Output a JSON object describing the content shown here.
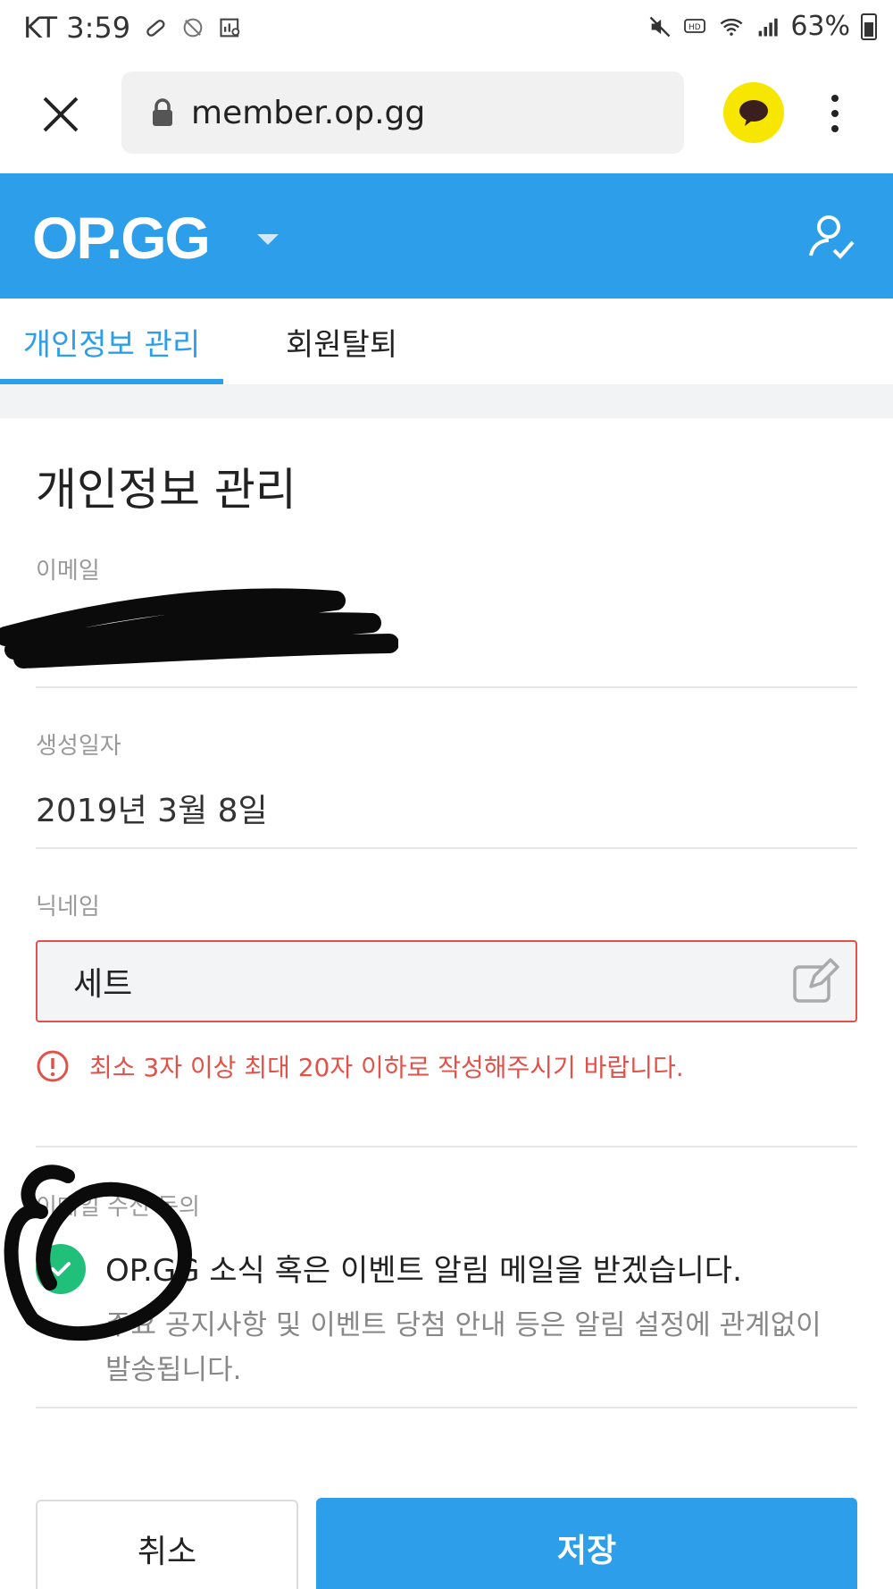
{
  "status_bar": {
    "carrier_time": "KT 3:59",
    "battery": "63%"
  },
  "browser": {
    "url": "member.op.gg"
  },
  "header": {
    "logo": "OP.GG"
  },
  "tabs": [
    {
      "label": "개인정보 관리",
      "active": true
    },
    {
      "label": "회원탈퇴",
      "active": false
    }
  ],
  "main": {
    "title": "개인정보 관리",
    "email_label": "이메일",
    "created_label": "생성일자",
    "created_value": "2019년 3월 8일",
    "nickname_label": "닉네임",
    "nickname_value": "세트",
    "nickname_error": "최소 3자 이상 최대 20자 이하로 작성해주시기 바랍니다.",
    "consent_label": "이메일 수신 동의",
    "consent_text": "OP.GG 소식 혹은 이벤트 알림 메일을 받겠습니다.",
    "consent_note": "주요 공지사항 및 이벤트 당첨 안내 등은 알림 설정에 관계없이 발송됩니다.",
    "consent_checked": true
  },
  "buttons": {
    "cancel": "취소",
    "save": "저장"
  },
  "colors": {
    "brand": "#2d9ee9",
    "error": "#e0524a",
    "check": "#21c07a",
    "kakao": "#f7e600"
  }
}
